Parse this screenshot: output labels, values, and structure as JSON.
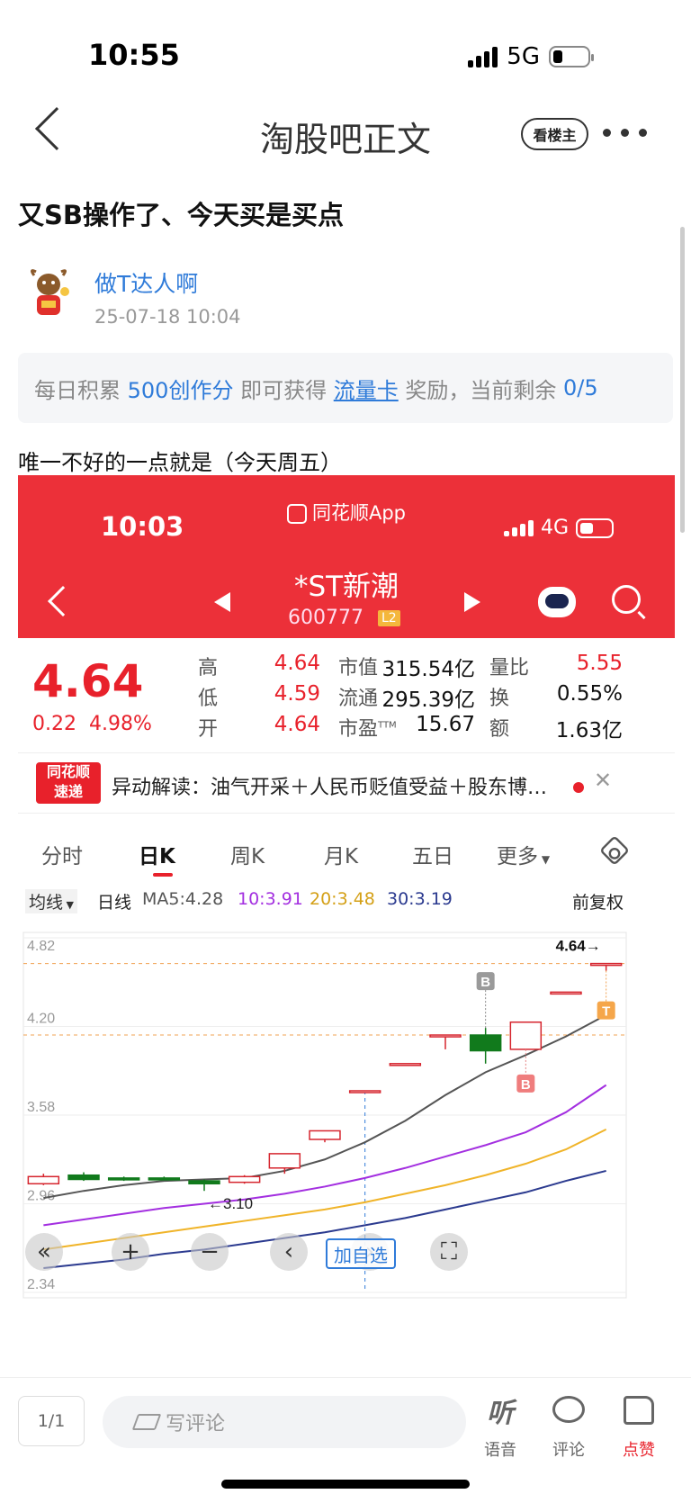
{
  "status_bar": {
    "time": "10:55",
    "network": "5G"
  },
  "nav": {
    "title": "淘股吧正文",
    "owner_button": "看楼主"
  },
  "post": {
    "title": "又SB操作了、今天买是买点",
    "author": "做T达人啊",
    "time": "25-07-18 10:04",
    "text": "唯一不好的一点就是（今天周五）"
  },
  "banner": {
    "part1": "每日积累",
    "score": "500创作分",
    "part2": "即可获得",
    "link": "流量卡",
    "part3": "奖励，当前剩余",
    "remain": "0/5"
  },
  "shot": {
    "time": "10:03",
    "app_name": "同花顺App",
    "network": "4G",
    "stock_name": "*ST新潮",
    "stock_code": "600777",
    "level": "L2",
    "price": "4.64",
    "change": "0.22",
    "change_pct": "4.98%",
    "quotes": {
      "high_label": "高",
      "high": "4.64",
      "low_label": "低",
      "low": "4.59",
      "open_label": "开",
      "open": "4.64",
      "mcap_label": "市值",
      "mcap": "315.54亿",
      "float_label": "流通",
      "float": "295.39亿",
      "pe_label": "市盈",
      "pe_sup": "TTM",
      "pe": "15.67",
      "vr_label": "量比",
      "vr": "5.55",
      "turn_label": "换",
      "turn": "0.55%",
      "amt_label": "额",
      "amt": "1.63亿"
    },
    "news": {
      "logo_line1": "同花顺",
      "logo_line2": "速递",
      "text": "异动解读：油气开采＋人民币贬值受益＋股东博…"
    },
    "tabs": [
      "分时",
      "日K",
      "周K",
      "月K",
      "五日",
      "更多"
    ],
    "ma_row": {
      "selector": "均线",
      "period": "日线",
      "ma5": "MA5:4.28",
      "ma10": "10:3.91",
      "ma20": "20:3.48",
      "ma30": "30:3.19",
      "adjust": "前复权"
    },
    "add_fav": "加自选",
    "colors": {
      "up": "#d6252e",
      "down": "#117a1c",
      "ma5": "#555555",
      "ma10": "#a32fe0",
      "ma20": "#f0b429",
      "ma30": "#2b3a8f"
    }
  },
  "chart_data": {
    "type": "candlestick",
    "ylim": [
      2.34,
      4.82
    ],
    "y_ticks": [
      "4.82",
      "4.20",
      "3.58",
      "2.96",
      "2.34"
    ],
    "candles": [
      {
        "o": 3.1,
        "h": 3.17,
        "l": 3.09,
        "c": 3.15
      },
      {
        "o": 3.16,
        "h": 3.18,
        "l": 3.12,
        "c": 3.13
      },
      {
        "o": 3.14,
        "h": 3.15,
        "l": 3.12,
        "c": 3.13
      },
      {
        "o": 3.14,
        "h": 3.15,
        "l": 3.13,
        "c": 3.13
      },
      {
        "o": 3.12,
        "h": 3.13,
        "l": 3.05,
        "c": 3.1
      },
      {
        "o": 3.11,
        "h": 3.16,
        "l": 3.1,
        "c": 3.15
      },
      {
        "o": 3.21,
        "h": 3.31,
        "l": 3.17,
        "c": 3.31
      },
      {
        "o": 3.41,
        "h": 3.47,
        "l": 3.39,
        "c": 3.47
      },
      {
        "o": 3.75,
        "h": 3.75,
        "l": 3.75,
        "c": 3.75
      },
      {
        "o": 3.94,
        "h": 3.94,
        "l": 3.94,
        "c": 3.94
      },
      {
        "o": 4.14,
        "h": 4.14,
        "l": 4.04,
        "c": 4.14
      },
      {
        "o": 4.14,
        "h": 4.19,
        "l": 3.94,
        "c": 4.03
      },
      {
        "o": 4.04,
        "h": 4.23,
        "l": 4.04,
        "c": 4.23
      },
      {
        "o": 4.44,
        "h": 4.44,
        "l": 4.44,
        "c": 4.44
      },
      {
        "o": 4.64,
        "h": 4.64,
        "l": 4.59,
        "c": 4.64
      }
    ],
    "ma5": [
      3.0,
      3.05,
      3.09,
      3.12,
      3.13,
      3.14,
      3.19,
      3.27,
      3.39,
      3.54,
      3.72,
      3.88,
      4.0,
      4.13,
      4.28
    ],
    "ma10": [
      2.81,
      2.85,
      2.89,
      2.93,
      2.96,
      2.99,
      3.03,
      3.08,
      3.14,
      3.21,
      3.29,
      3.37,
      3.46,
      3.6,
      3.79
    ],
    "ma20": [
      2.64,
      2.68,
      2.72,
      2.76,
      2.8,
      2.84,
      2.88,
      2.92,
      2.97,
      3.03,
      3.09,
      3.16,
      3.24,
      3.34,
      3.48
    ],
    "ma30": [
      2.51,
      2.54,
      2.57,
      2.61,
      2.64,
      2.68,
      2.72,
      2.76,
      2.81,
      2.86,
      2.92,
      2.98,
      3.04,
      3.12,
      3.19
    ],
    "annotations": {
      "low_label": "←3.10",
      "high_label": "4.64→",
      "buy": "B",
      "sell": "T"
    },
    "ref_lines": [
      4.64,
      4.14
    ]
  },
  "bottom_bar": {
    "page": "1/1",
    "comment_placeholder": "写评论",
    "voice_label": "语音",
    "voice_glyph": "听",
    "comment_label": "评论",
    "like_label": "点赞"
  }
}
